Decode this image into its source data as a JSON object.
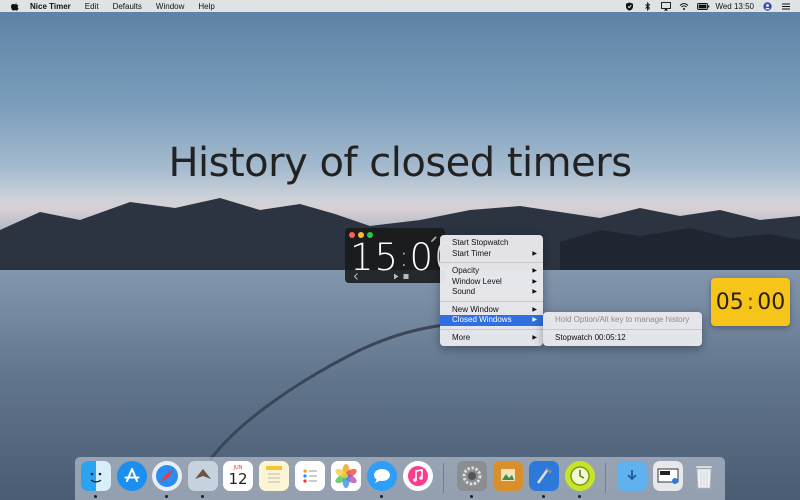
{
  "menubar": {
    "app_name": "Nice Timer",
    "menus": [
      "Edit",
      "Defaults",
      "Window",
      "Help"
    ],
    "clock": "Wed 13:50"
  },
  "headline": "History of closed timers",
  "timer_window": {
    "time_main": "15",
    "time_colon": ":",
    "time_rest": "00"
  },
  "context_menu": {
    "items": [
      {
        "label": "Start Stopwatch"
      },
      {
        "label": "Start Timer"
      },
      {
        "label": "Opacity"
      },
      {
        "label": "Window Level"
      },
      {
        "label": "Sound"
      },
      {
        "label": "New Window"
      },
      {
        "label": "Closed Windows"
      },
      {
        "label": "More"
      }
    ]
  },
  "submenu": {
    "hint": "Hold Option/Alt key to manage history",
    "entry": "Stopwatch 00:05:12"
  },
  "yellow_timer": {
    "minutes": "05",
    "colon": ":",
    "seconds": "00"
  },
  "dock": {
    "calendar_month": "JUN",
    "calendar_day": "12"
  },
  "colors": {
    "selection": "#2f6fe2",
    "yellow_timer": "#f7c51a"
  }
}
